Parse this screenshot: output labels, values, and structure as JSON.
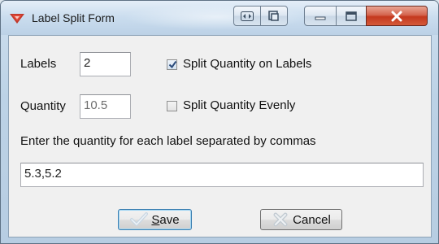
{
  "window": {
    "title": "Label Split Form",
    "icon": "app-logo-icon",
    "controls": [
      "resize-icon",
      "restore-icon",
      "minimize-icon",
      "maximize-icon",
      "close-icon"
    ]
  },
  "form": {
    "labels_label": "Labels",
    "labels_value": "2",
    "quantity_label": "Quantity",
    "quantity_value": "10.5",
    "split_on_labels_label": "Split Quantity on Labels",
    "split_on_labels_checked": true,
    "split_evenly_label": "Split Quantity Evenly",
    "split_evenly_checked": false,
    "instruction": "Enter the quantity for each label separated by commas",
    "quantities_value": "5.3,5.2"
  },
  "buttons": {
    "save_label_mnemonic": "S",
    "save_label_rest": "ave",
    "cancel_label": "Cancel"
  },
  "colors": {
    "title_bar": "#c9dcee",
    "client_bg": "#f0f0f0",
    "close_button": "#c4381e",
    "default_button_border": "#3c7fb1"
  }
}
